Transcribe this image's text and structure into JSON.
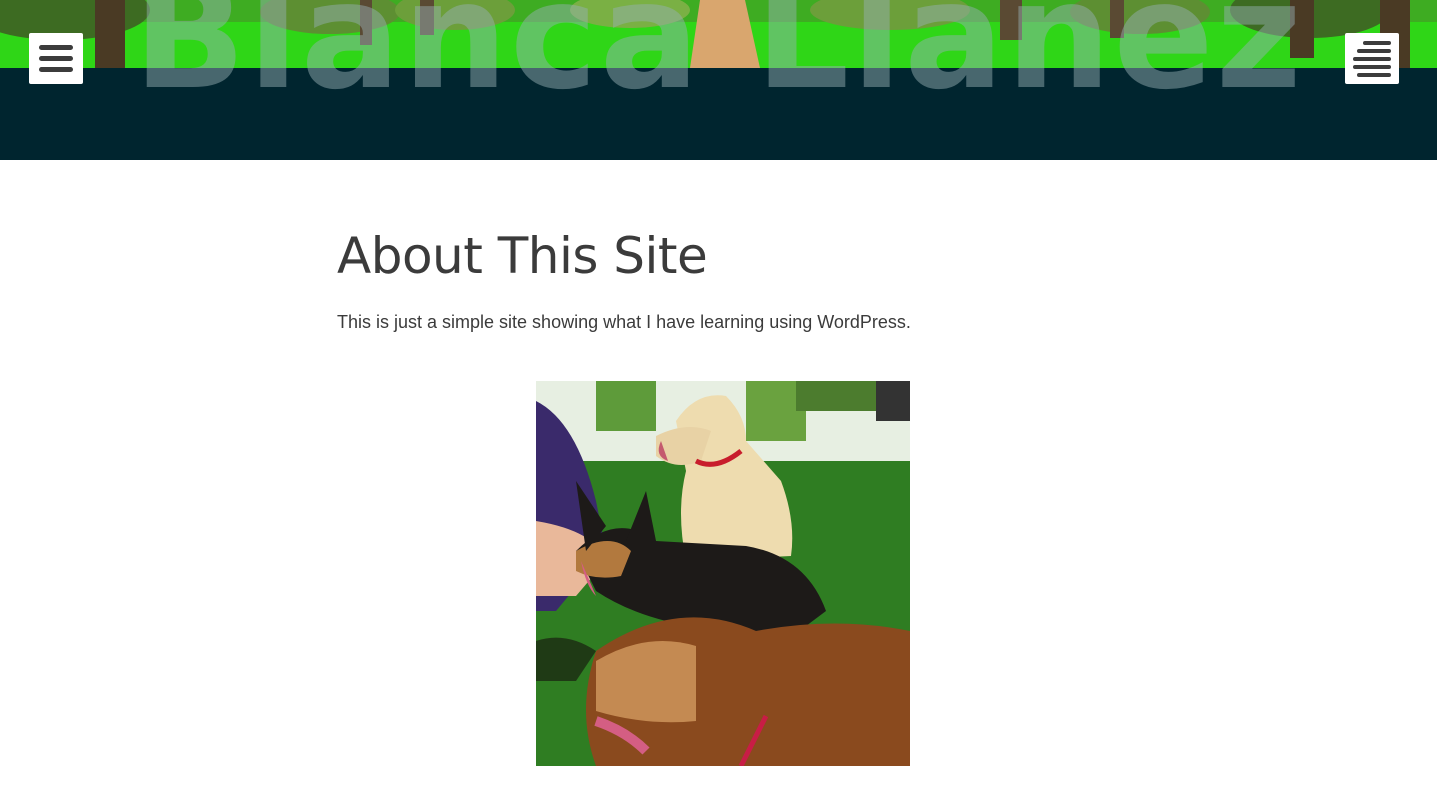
{
  "header": {
    "site_title": "Blanca Llanez",
    "left_menu_icon": "hamburger-menu-icon",
    "right_menu_icon": "stacked-lines-icon",
    "colors": {
      "header_bg": "#00252f",
      "banner_green": "#27e314"
    }
  },
  "main": {
    "page_title": "About This Site",
    "intro": "This is just a simple site showing what I have learning using WordPress."
  },
  "photo": {
    "description_icon": "dogs-photo",
    "colors": {
      "grass": "#2f7d22"
    }
  }
}
